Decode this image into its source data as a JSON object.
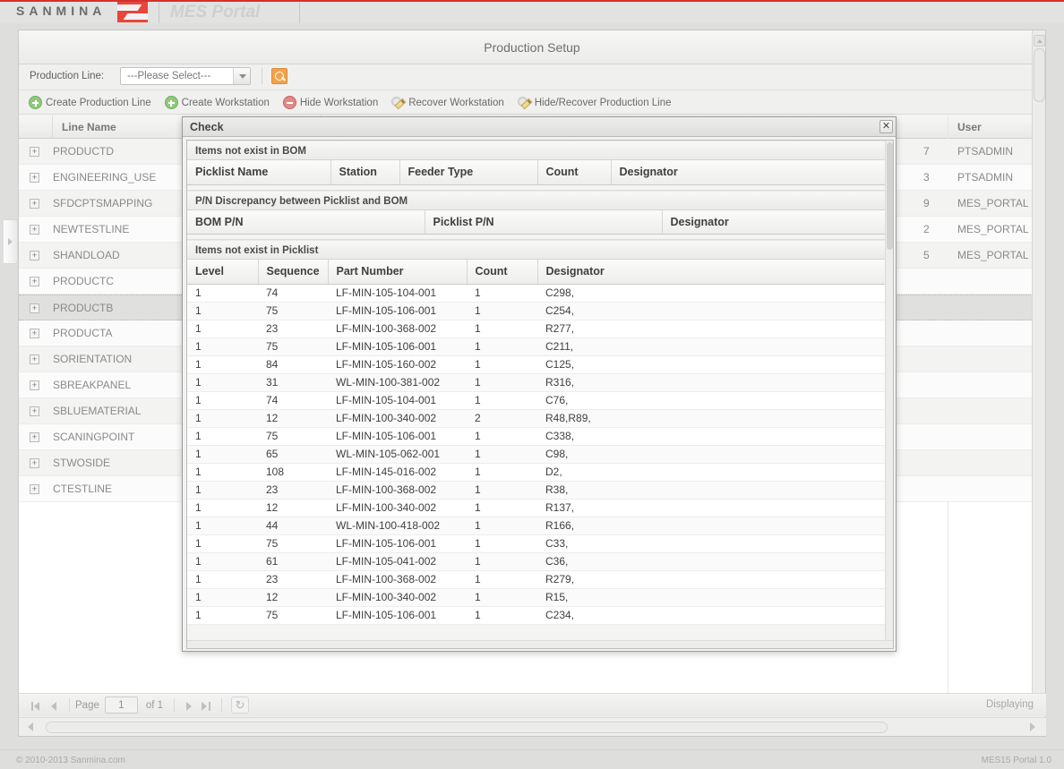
{
  "brand": {
    "company": "SANMINA",
    "product": "MES Portal",
    "logo_icon": "sanmina-logo-icon"
  },
  "panel": {
    "title": "Production Setup"
  },
  "filter": {
    "label": "Production Line:",
    "select_value": "---Please Select---",
    "search_icon": "magnifier-icon"
  },
  "toolbar": {
    "buttons": [
      {
        "label": "Create Production Line",
        "icon": "plus-circle-icon"
      },
      {
        "label": "Create Workstation",
        "icon": "plus-circle-icon"
      },
      {
        "label": "Hide Workstation",
        "icon": "minus-circle-icon"
      },
      {
        "label": "Recover Workstation",
        "icon": "pencil-edit-icon"
      },
      {
        "label": "Hide/Recover Production Line",
        "icon": "pencil-edit-icon"
      }
    ]
  },
  "grid": {
    "columns": [
      "Line Name",
      "User"
    ],
    "rows": [
      {
        "name": "PRODUCTD",
        "num": "7",
        "user": "PTSADMIN",
        "selected": false
      },
      {
        "name": "ENGINEERING_USE",
        "num": "3",
        "user": "PTSADMIN",
        "selected": false
      },
      {
        "name": "SFDCPTSMAPPING",
        "num": "9",
        "user": "MES_PORTAL",
        "selected": false
      },
      {
        "name": "NEWTESTLINE",
        "num": "2",
        "user": "MES_PORTAL",
        "selected": false
      },
      {
        "name": "SHANDLOAD",
        "num": "5",
        "user": "MES_PORTAL",
        "selected": false
      },
      {
        "name": "PRODUCTC",
        "num": "",
        "user": "",
        "selected": false
      },
      {
        "name": "PRODUCTB",
        "num": "",
        "user": "",
        "selected": true
      },
      {
        "name": "PRODUCTA",
        "num": "",
        "user": "",
        "selected": false
      },
      {
        "name": "SORIENTATION",
        "num": "",
        "user": "",
        "selected": false
      },
      {
        "name": "SBREAKPANEL",
        "num": "",
        "user": "",
        "selected": false
      },
      {
        "name": "SBLUEMATERIAL",
        "num": "",
        "user": "",
        "selected": false
      },
      {
        "name": "SCANINGPOINT",
        "num": "",
        "user": "",
        "selected": false
      },
      {
        "name": "STWOSIDE",
        "num": "",
        "user": "",
        "selected": false
      },
      {
        "name": "CTESTLINE",
        "num": "",
        "user": "",
        "selected": false
      }
    ]
  },
  "pager": {
    "first_icon": "first-page-icon",
    "prev_icon": "prev-page-icon",
    "page_label": "Page",
    "page_value": "1",
    "of_label": "of 1",
    "next_icon": "next-page-icon",
    "last_icon": "last-page-icon",
    "refresh_icon": "refresh-icon",
    "displaying": "Displaying"
  },
  "dialog": {
    "title": "Check",
    "close_icon": "close-icon",
    "sections": [
      {
        "heading": "Items not exist in BOM",
        "columns": [
          "Picklist Name",
          "Station",
          "Feeder Type",
          "Count",
          "Designator"
        ],
        "rows": []
      },
      {
        "heading": "P/N Discrepancy between Picklist and BOM",
        "columns": [
          "BOM P/N",
          "Picklist P/N",
          "Designator"
        ],
        "rows": []
      },
      {
        "heading": "Items not exist in Picklist",
        "columns": [
          "Level",
          "Sequence",
          "Part Number",
          "Count",
          "Designator"
        ],
        "rows": [
          [
            "1",
            "74",
            "LF-MIN-105-104-001",
            "1",
            "C298,"
          ],
          [
            "1",
            "75",
            "LF-MIN-105-106-001",
            "1",
            "C254,"
          ],
          [
            "1",
            "23",
            "LF-MIN-100-368-002",
            "1",
            "R277,"
          ],
          [
            "1",
            "75",
            "LF-MIN-105-106-001",
            "1",
            "C211,"
          ],
          [
            "1",
            "84",
            "LF-MIN-105-160-002",
            "1",
            "C125,"
          ],
          [
            "1",
            "31",
            "WL-MIN-100-381-002",
            "1",
            "R316,"
          ],
          [
            "1",
            "74",
            "LF-MIN-105-104-001",
            "1",
            "C76,"
          ],
          [
            "1",
            "12",
            "LF-MIN-100-340-002",
            "2",
            "R48,R89,"
          ],
          [
            "1",
            "75",
            "LF-MIN-105-106-001",
            "1",
            "C338,"
          ],
          [
            "1",
            "65",
            "WL-MIN-105-062-001",
            "1",
            "C98,"
          ],
          [
            "1",
            "108",
            "LF-MIN-145-016-002",
            "1",
            "D2,"
          ],
          [
            "1",
            "23",
            "LF-MIN-100-368-002",
            "1",
            "R38,"
          ],
          [
            "1",
            "12",
            "LF-MIN-100-340-002",
            "1",
            "R137,"
          ],
          [
            "1",
            "44",
            "WL-MIN-100-418-002",
            "1",
            "R166,"
          ],
          [
            "1",
            "75",
            "LF-MIN-105-106-001",
            "1",
            "C33,"
          ],
          [
            "1",
            "61",
            "LF-MIN-105-041-002",
            "1",
            "C36,"
          ],
          [
            "1",
            "23",
            "LF-MIN-100-368-002",
            "1",
            "R279,"
          ],
          [
            "1",
            "12",
            "LF-MIN-100-340-002",
            "1",
            "R15,"
          ],
          [
            "1",
            "75",
            "LF-MIN-105-106-001",
            "1",
            "C234,"
          ]
        ]
      }
    ]
  },
  "footer": {
    "copyright": "© 2010-2013 Sanmina.com",
    "version": "MES15 Portal 1.0"
  },
  "colors": {
    "accent_red": "#d2322d",
    "logo_red": "#e8453c",
    "search_orange": "#f3a24b",
    "add_green": "#8fc97e",
    "remove_red": "#e08b88"
  }
}
